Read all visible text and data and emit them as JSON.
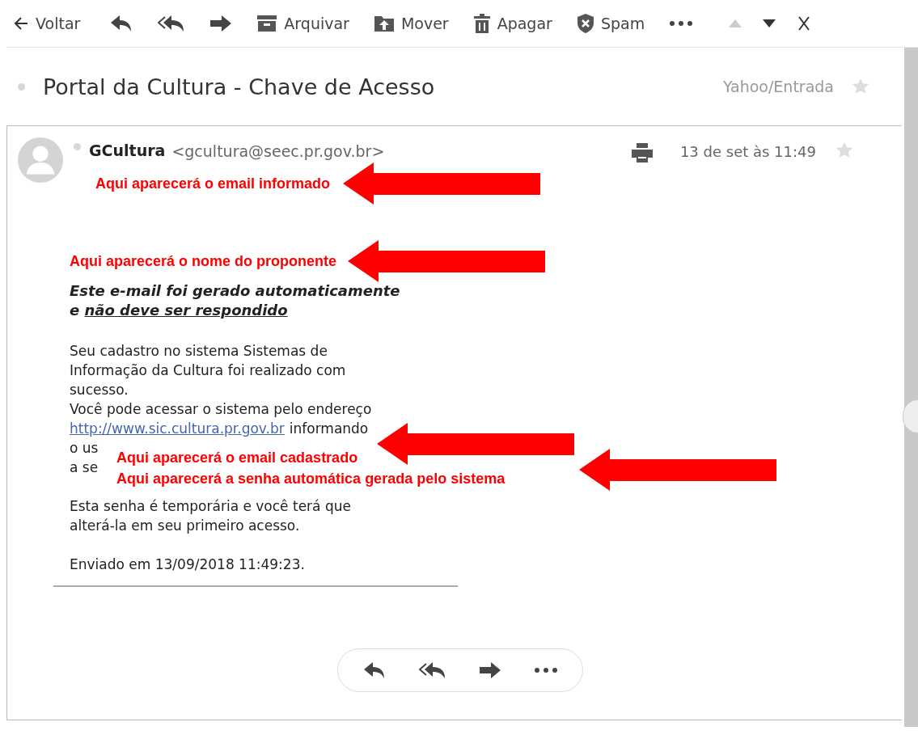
{
  "toolbar": [
    {
      "kind": "back",
      "label": "Voltar"
    },
    {
      "kind": "reply"
    },
    {
      "kind": "reply_all"
    },
    {
      "kind": "forward"
    },
    {
      "kind": "archive",
      "label": "Arquivar"
    },
    {
      "kind": "move",
      "label": "Mover"
    },
    {
      "kind": "delete",
      "label": "Apagar"
    },
    {
      "kind": "spam",
      "label": "Spam"
    },
    {
      "kind": "more"
    },
    {
      "kind": "previous",
      "disabled": true
    },
    {
      "kind": "next",
      "disabled": false
    },
    {
      "kind": "close"
    }
  ],
  "subject": {
    "title": "Portal da Cultura - Chave de Acesso",
    "folder": "Yahoo/Entrada",
    "starred": false
  },
  "message": {
    "sender_name": "GCultura",
    "sender_email": "<gcultura@seec.pr.gov.br>",
    "date": "13 de set às 11:49",
    "starred": false,
    "notice_line_1": "Este e-mail foi gerado automaticamente",
    "notice_prefix": "e",
    "notice_underlined": "não deve ser respondido",
    "paragraph_1": "Seu cadastro no sistema Sistemas de Informação da Cultura foi realizado com sucesso.",
    "paragraph_2": "Você pode acessar o sistema pelo endereço",
    "link": "http://www.sic.cultura.pr.gov.br",
    "after_link": "informando",
    "covered_lines": [
      "o us",
      "a se"
    ],
    "paragraph_3": "Esta senha é temporária e você terá que alterá-la em seu primeiro acesso.",
    "sent": "Enviado em 13/09/2018 11:49:23."
  },
  "message_actions": [
    {
      "kind": "reply"
    },
    {
      "kind": "reply_all"
    },
    {
      "kind": "forward"
    },
    {
      "kind": "more"
    }
  ],
  "annotations": [
    {
      "kind": "single",
      "text": "Aqui aparecerá o email informado"
    },
    {
      "kind": "single",
      "text": "Aqui aparecerá o nome do proponente"
    },
    {
      "kind": "box",
      "lines": [
        "Aqui aparecerá o email cadastrado",
        "Aqui aparecerá a senha automática gerada pelo sistema"
      ]
    }
  ]
}
